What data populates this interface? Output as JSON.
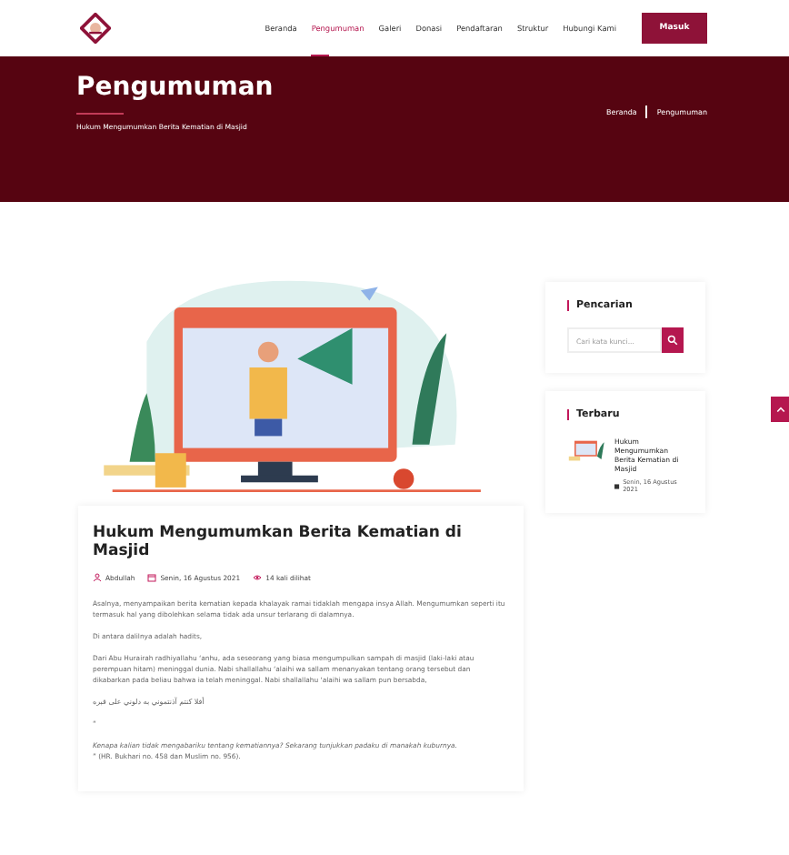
{
  "nav": {
    "items": [
      {
        "label": "Beranda",
        "selected": false
      },
      {
        "label": "Pengumuman",
        "selected": true
      },
      {
        "label": "Galeri",
        "selected": false
      },
      {
        "label": "Donasi",
        "selected": false
      },
      {
        "label": "Pendaftaran",
        "selected": false
      },
      {
        "label": "Struktur",
        "selected": false
      },
      {
        "label": "Hubungi Kami",
        "selected": false
      }
    ],
    "login_button": "Masuk"
  },
  "banner": {
    "title": "Pengumuman",
    "subtitle": "Hukum Mengumumkan Berita Kematian di Masjid",
    "breadcrumb": [
      "Beranda",
      "Pengumuman"
    ]
  },
  "article": {
    "title": "Hukum Mengumumkan Berita Kematian di Masjid",
    "author": "Abdullah",
    "date": "Senin, 16 Agustus 2021",
    "views": "14 kali dilihat",
    "paragraphs": [
      {
        "kind": "text",
        "text": "Asalnya, menyampaikan berita kematian kepada khalayak ramai tidaklah mengapa insya Allah. Mengumumkan seperti itu termasuk hal yang dibolehkan selama tidak ada unsur terlarang di dalamnya."
      },
      {
        "kind": "text",
        "text": "Di antara dalilnya adalah hadits,"
      },
      {
        "kind": "text",
        "text": "Dari Abu Hurairah radhiyallahu ‘anhu, ada seseorang yang biasa mengumpulkan sampah di masjid (laki-laki atau perempuan hitam) meninggal dunia. Nabi shallallahu ‘alaihi wa sallam menanyakan tentang orang tersebut dan dikabarkan pada beliau bahwa ia telah meninggal. Nabi shallallahu ‘alaihi wa sallam pun bersabda,"
      },
      {
        "kind": "arabic",
        "text": "أفلا كنتم آذنتموني به دلوني على قبره"
      },
      {
        "kind": "text",
        "text": "“"
      },
      {
        "kind": "italic",
        "text": "Kenapa kalian tidak mengabariku tentang kematiannya? Sekarang tunjukkan padaku di manakah kuburnya."
      },
      {
        "kind": "text",
        "text": "” (HR. Bukhari no. 458 dan Muslim no. 956)."
      }
    ]
  },
  "sidebar": {
    "search": {
      "title": "Pencarian",
      "placeholder": "Cari kata kunci..."
    },
    "latest": {
      "title": "Terbaru",
      "items": [
        {
          "title": "Hukum Mengumumkan Berita Kematian di Masjid",
          "date": "Senin, 16 Agustus 2021"
        }
      ]
    }
  }
}
